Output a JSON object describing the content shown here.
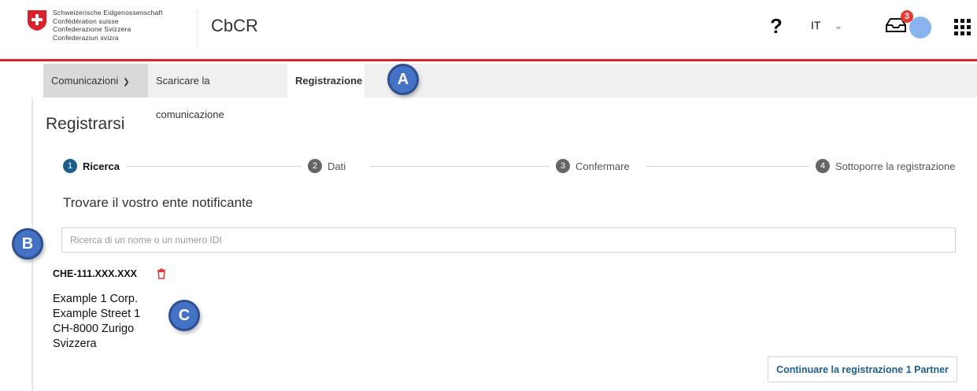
{
  "header": {
    "confederation_lines": [
      "Schweizerische Eidgenossenschaft",
      "Confédération suisse",
      "Confederazione Svizzera",
      "Confederaziun svizra"
    ],
    "app_title": "CbCR",
    "help_label": "?",
    "language": "IT",
    "notification_count": "3",
    "icons": {
      "flag": "swiss-flag-icon",
      "help": "help-icon",
      "chevron": "chevron-down-icon",
      "inbox": "inbox-icon",
      "avatar": "avatar",
      "apps": "apps-grid-icon"
    }
  },
  "nav": {
    "items": [
      {
        "label": "Comunicazioni",
        "has_dropdown": true
      },
      {
        "label": "Scaricare la comunicazione"
      },
      {
        "label": "Registrazione",
        "active": true
      }
    ]
  },
  "page": {
    "title": "Registrarsi",
    "steps": [
      {
        "number": "1",
        "label": "Ricerca",
        "active": true
      },
      {
        "number": "2",
        "label": "Dati"
      },
      {
        "number": "3",
        "label": "Confermare"
      },
      {
        "number": "4",
        "label": "Sottoporre la registrazione"
      }
    ],
    "section_title": "Trovare il vostro ente notificante",
    "search_placeholder": "Ricerca di un nome o un numero IDI",
    "result": {
      "id": "CHE-111.XXX.XXX",
      "address": [
        "Example 1 Corp.",
        "Example Street 1",
        "CH-8000 Zurigo",
        "Svizzera"
      ]
    },
    "continue_button": "Continuare la registrazione 1 Partner"
  },
  "callouts": [
    "A",
    "B",
    "C"
  ],
  "colors": {
    "accent_red": "#d8232a",
    "primary_blue": "#1d5e8a",
    "callout_blue": "#4472c4"
  }
}
